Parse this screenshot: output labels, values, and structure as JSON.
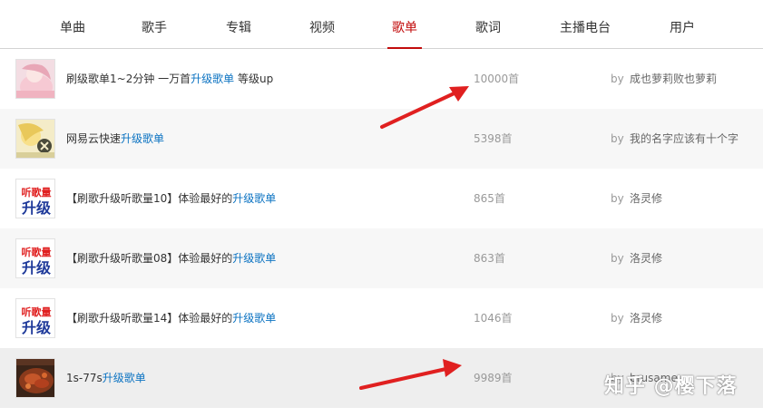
{
  "tabs": [
    {
      "label": "单曲",
      "active": false
    },
    {
      "label": "歌手",
      "active": false
    },
    {
      "label": "专辑",
      "active": false
    },
    {
      "label": "视频",
      "active": false
    },
    {
      "label": "歌单",
      "active": true
    },
    {
      "label": "歌词",
      "active": false
    },
    {
      "label": "主播电台",
      "active": false
    },
    {
      "label": "用户",
      "active": false
    }
  ],
  "rows": [
    {
      "title_pre": "刷级歌单1~2分钟 一万首",
      "title_hl": "升级歌单",
      "title_post": " 等级up",
      "count": "10000首",
      "by": "by",
      "author": "成也萝莉败也萝莉",
      "cover": "anime-pink-icon"
    },
    {
      "title_pre": "网易云快速",
      "title_hl": "升级歌单",
      "title_post": "",
      "count": "5398首",
      "by": "by",
      "author": "我的名字应该有十个字",
      "cover": "anime-yellow-icon"
    },
    {
      "title_pre": "【刷歌升级听歌量10】体验最好的",
      "title_hl": "升级歌单",
      "title_post": "",
      "count": "865首",
      "by": "by",
      "author": "洛灵修",
      "cover": "upgrade-text-cover",
      "cover_text": [
        "听歌量",
        "升级"
      ]
    },
    {
      "title_pre": "【刷歌升级听歌量08】体验最好的",
      "title_hl": "升级歌单",
      "title_post": "",
      "count": "863首",
      "by": "by",
      "author": "洛灵修",
      "cover": "upgrade-text-cover",
      "cover_text": [
        "听歌量",
        "升级"
      ]
    },
    {
      "title_pre": "【刷歌升级听歌量14】体验最好的",
      "title_hl": "升级歌单",
      "title_post": "",
      "count": "1046首",
      "by": "by",
      "author": "洛灵修",
      "cover": "upgrade-text-cover",
      "cover_text": [
        "听歌量",
        "升级"
      ]
    },
    {
      "title_pre": "1s-77s",
      "title_hl": "升级歌单",
      "title_post": "",
      "count": "9989首",
      "by": "by",
      "author": "brusame",
      "cover": "food-photo-icon"
    }
  ],
  "watermark": "知乎 @樱下落",
  "colors": {
    "accent_red": "#c20c0c",
    "link_blue": "#0c73c2",
    "arrow_red": "#e02020"
  }
}
